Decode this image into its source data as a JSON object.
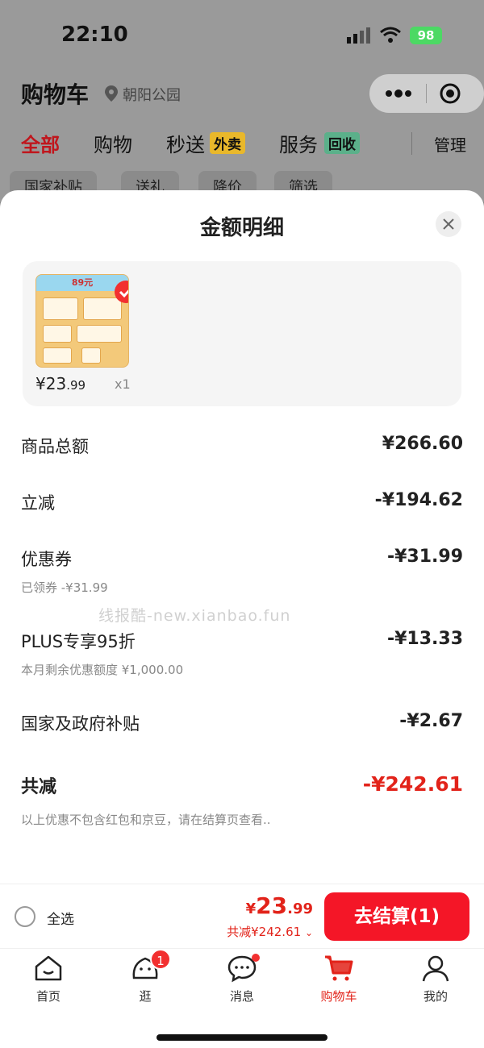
{
  "status": {
    "time": "22:10",
    "battery": "98"
  },
  "header": {
    "title": "购物车",
    "location": "朝阳公园"
  },
  "tabs": [
    {
      "label": "全部"
    },
    {
      "label": "购物"
    },
    {
      "label": "秒送",
      "badge": "外卖"
    },
    {
      "label": "服务",
      "badge": "回收"
    }
  ],
  "manage_label": "管理",
  "chips": [
    "国家补贴",
    "送礼",
    "降价",
    "筛选"
  ],
  "sheet": {
    "title": "金额明细",
    "product": {
      "ribbon": "89元",
      "price_int": "¥23",
      "price_dec": ".99",
      "qty": "x1"
    },
    "rows": [
      {
        "label": "商品总额",
        "value": "¥266.60"
      },
      {
        "label": "立减",
        "value": "-¥194.62"
      },
      {
        "label": "优惠券",
        "value": "-¥31.99",
        "sub": "已领券 -¥31.99"
      },
      {
        "label": "PLUS专享95折",
        "value": "-¥13.33",
        "sub": "本月剩余优惠额度 ¥1,000.00"
      },
      {
        "label": "国家及政府补贴",
        "value": "-¥2.67"
      }
    ],
    "total": {
      "label": "共减",
      "value": "-¥242.61"
    },
    "note": "以上优惠不包含红包和京豆，请在结算页查看..",
    "watermark": "线报酷-new.xianbao.fun"
  },
  "checkout": {
    "select_all": "全选",
    "price_yen": "¥",
    "price_int": "23",
    "price_dec": ".99",
    "saved": "共减¥242.61",
    "button": "去结算(1)"
  },
  "tabbar": [
    {
      "label": "首页",
      "icon": "home-icon"
    },
    {
      "label": "逛",
      "icon": "explore-icon",
      "badge": "1"
    },
    {
      "label": "消息",
      "icon": "message-icon"
    },
    {
      "label": "购物车",
      "icon": "cart-icon"
    },
    {
      "label": "我的",
      "icon": "profile-icon"
    }
  ],
  "colors": {
    "accent": "#e2231a",
    "button": "#f41627"
  }
}
